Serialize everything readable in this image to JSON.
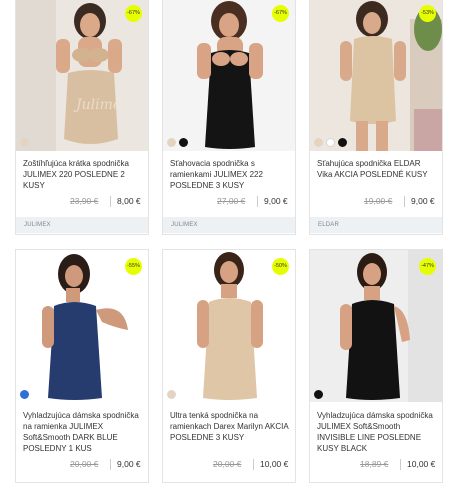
{
  "products": [
    {
      "title": "Zoštíhľujúca krátka spodnička JULIMEX 220 POSLEDNE 2 KUSY",
      "discount": "-67%",
      "old_price": "23,90 €",
      "new_price": "8,00 €",
      "brand": "JULIMEX",
      "swatches": [
        "#e8d2b8"
      ]
    },
    {
      "title": "Sťahovacia spodnička s ramienkami JULIMEX 222 POSLEDNE 3 KUSY",
      "discount": "-67%",
      "old_price": "27,00 €",
      "new_price": "9,00 €",
      "brand": "JULIMEX",
      "swatches": [
        "#e8d2b8",
        "#111111"
      ]
    },
    {
      "title": "Sťahujúca spodnička ELDAR Vika AKCIA POSLEDNÉ KUSY",
      "discount": "-53%",
      "old_price": "19,00 €",
      "new_price": "9,00 €",
      "brand": "ELDAR",
      "swatches": [
        "#e8d2b8",
        "#ffffff",
        "#111111"
      ]
    },
    {
      "title": "Vyhladzujúca dámska spodnička na ramienka JULIMEX Soft&Smooth DARK BLUE POSLEDNY 1 KUS",
      "discount": "-55%",
      "old_price": "20,00 €",
      "new_price": "9,00 €",
      "brand": "",
      "swatches": [
        "#2f6fd6"
      ]
    },
    {
      "title": "Ultra tenká spodnička na ramienkach Darex Marilyn AKCIA POSLEDNE 3 KUSY",
      "discount": "-50%",
      "old_price": "20,00 €",
      "new_price": "10,00 €",
      "brand": "",
      "swatches": [
        "#e8d2b8"
      ]
    },
    {
      "title": "Vyhladzujúca dámska spodnička JULIMEX Soft&Smooth INVISIBLE LINE POSLEDNE KUSY BLACK",
      "discount": "-47%",
      "old_price": "18,89 €",
      "new_price": "10,00 €",
      "brand": "",
      "swatches": [
        "#111111"
      ]
    }
  ]
}
